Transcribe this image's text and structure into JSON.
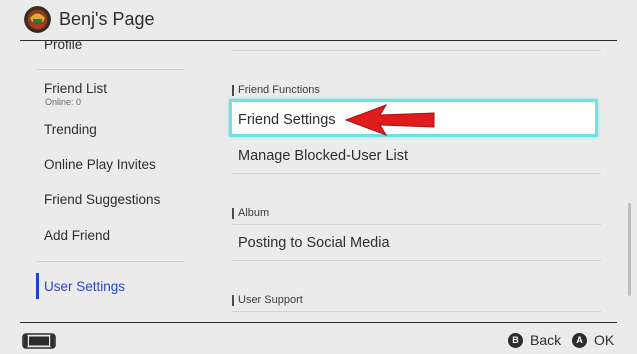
{
  "header": {
    "title": "Benj's Page",
    "avatar_icon": "user-avatar-icon"
  },
  "sidebar": {
    "items": [
      {
        "label": "Profile"
      },
      {
        "label": "Friend List",
        "sublabel": "Online: 0"
      },
      {
        "label": "Trending"
      },
      {
        "label": "Online Play Invites"
      },
      {
        "label": "Friend Suggestions"
      },
      {
        "label": "Add Friend"
      },
      {
        "label": "User Settings",
        "active": true
      }
    ]
  },
  "main": {
    "sections": [
      {
        "label": "Friend Functions",
        "items": [
          {
            "label": "Friend Settings",
            "focused": true
          },
          {
            "label": "Manage Blocked-User List"
          }
        ]
      },
      {
        "label": "Album",
        "items": [
          {
            "label": "Posting to Social Media"
          }
        ]
      },
      {
        "label": "User Support",
        "items": []
      }
    ]
  },
  "footer": {
    "console_icon": "console-icon",
    "hints": [
      {
        "button": "B",
        "label": "Back"
      },
      {
        "button": "A",
        "label": "OK"
      }
    ]
  },
  "colors": {
    "background": "#ebebeb",
    "accent": "#2b47c8",
    "focus_border": "#6fe3e3",
    "annotation_arrow": "#e01b1b"
  }
}
